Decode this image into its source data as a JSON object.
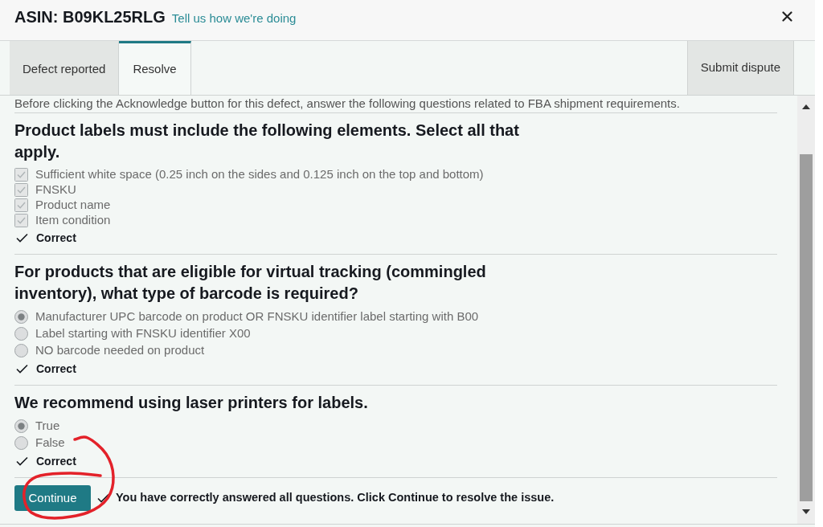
{
  "dialog": {
    "title": "ASIN: B09KL25RLG",
    "feedback_link": "Tell us how we're doing"
  },
  "tabs": [
    {
      "label": "Defect reported",
      "selected": false
    },
    {
      "label": "Resolve",
      "selected": true
    }
  ],
  "submit_button": {
    "label": "Submit dispute"
  },
  "instructions": "Before clicking the Acknowledge button for this defect, answer the following questions related to FBA shipment requirements.",
  "questions": [
    {
      "kind": "checkbox",
      "prompt": "Product labels must include the following elements. Select all that apply.",
      "options": [
        {
          "label": "Sufficient white space (0.25 inch on the sides and 0.125 inch on the top and bottom)",
          "checked": true
        },
        {
          "label": "FNSKU",
          "checked": true
        },
        {
          "label": "Product name",
          "checked": true
        },
        {
          "label": "Item condition",
          "checked": true
        }
      ],
      "result": "Correct"
    },
    {
      "kind": "radio",
      "prompt": "For products that are eligible for virtual tracking (commingled inventory), what type of barcode is required?",
      "options": [
        {
          "label": "Manufacturer UPC barcode on product OR FNSKU identifier label starting with B00",
          "selected": true
        },
        {
          "label": "Label starting with FNSKU identifier X00",
          "selected": false
        },
        {
          "label": "NO barcode needed on product",
          "selected": false
        }
      ],
      "result": "Correct"
    },
    {
      "kind": "radio",
      "prompt": "We recommend using laser printers for labels.",
      "options": [
        {
          "label": "True",
          "selected": true
        },
        {
          "label": "False",
          "selected": false
        }
      ],
      "result": "Correct"
    }
  ],
  "footer": {
    "button": "Continue",
    "message": "You have correctly answered all questions. Click Continue to resolve the issue."
  }
}
